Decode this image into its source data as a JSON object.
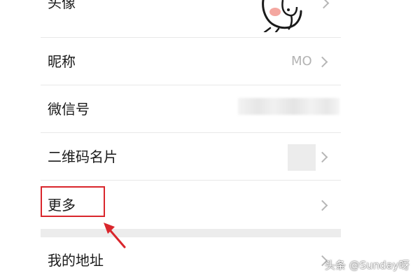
{
  "rows": {
    "avatar": {
      "label": "头像"
    },
    "nickname": {
      "label": "昵称",
      "value": "MO"
    },
    "wechat_id": {
      "label": "微信号"
    },
    "qr_code": {
      "label": "二维码名片"
    },
    "more": {
      "label": "更多"
    },
    "address": {
      "label": "我的地址"
    }
  },
  "watermark": {
    "text": "头条 @Sunday呀"
  },
  "colors": {
    "highlight": "#d9262c",
    "chevron": "#b6b6b6",
    "divider": "#e8e8e8",
    "section_gap": "#ececec"
  }
}
